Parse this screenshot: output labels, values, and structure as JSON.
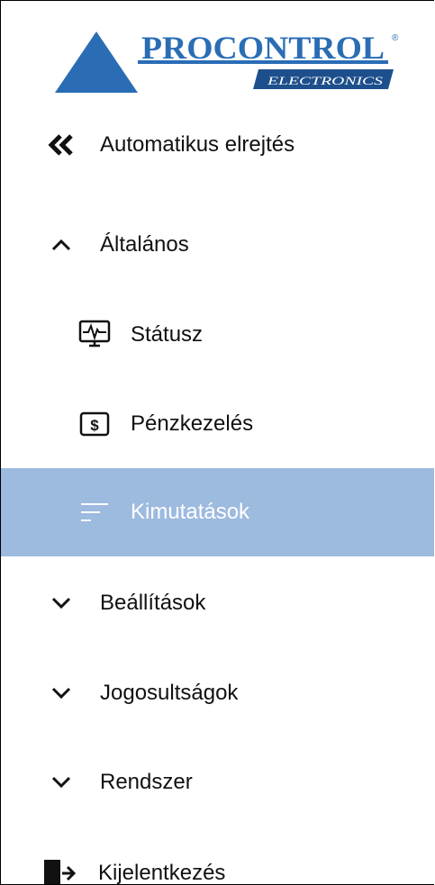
{
  "brand": {
    "name": "PROCONTROL",
    "sub": "ELECTRONICS",
    "mark": "®",
    "primary": "#2a6db5",
    "dark": "#1d4f8c"
  },
  "colors": {
    "selected_bg": "#9dbadf",
    "text": "#111111"
  },
  "menu": [
    {
      "label": "Automatikus elrejtés",
      "icon": "double-chevron-left-icon"
    },
    {
      "label": "Általános",
      "icon": "chevron-up-icon",
      "expanded": true
    },
    {
      "label": "Státusz",
      "icon": "monitor-pulse-icon"
    },
    {
      "label": "Pénzkezelés",
      "icon": "dollar-box-icon"
    },
    {
      "label": "Kimutatások",
      "icon": "report-lines-icon",
      "selected": true
    },
    {
      "label": "Beállítások",
      "icon": "chevron-down-icon"
    },
    {
      "label": "Jogosultságok",
      "icon": "chevron-down-icon"
    },
    {
      "label": "Rendszer",
      "icon": "chevron-down-icon"
    },
    {
      "label": "Kijelentkezés",
      "icon": "logout-icon"
    }
  ]
}
